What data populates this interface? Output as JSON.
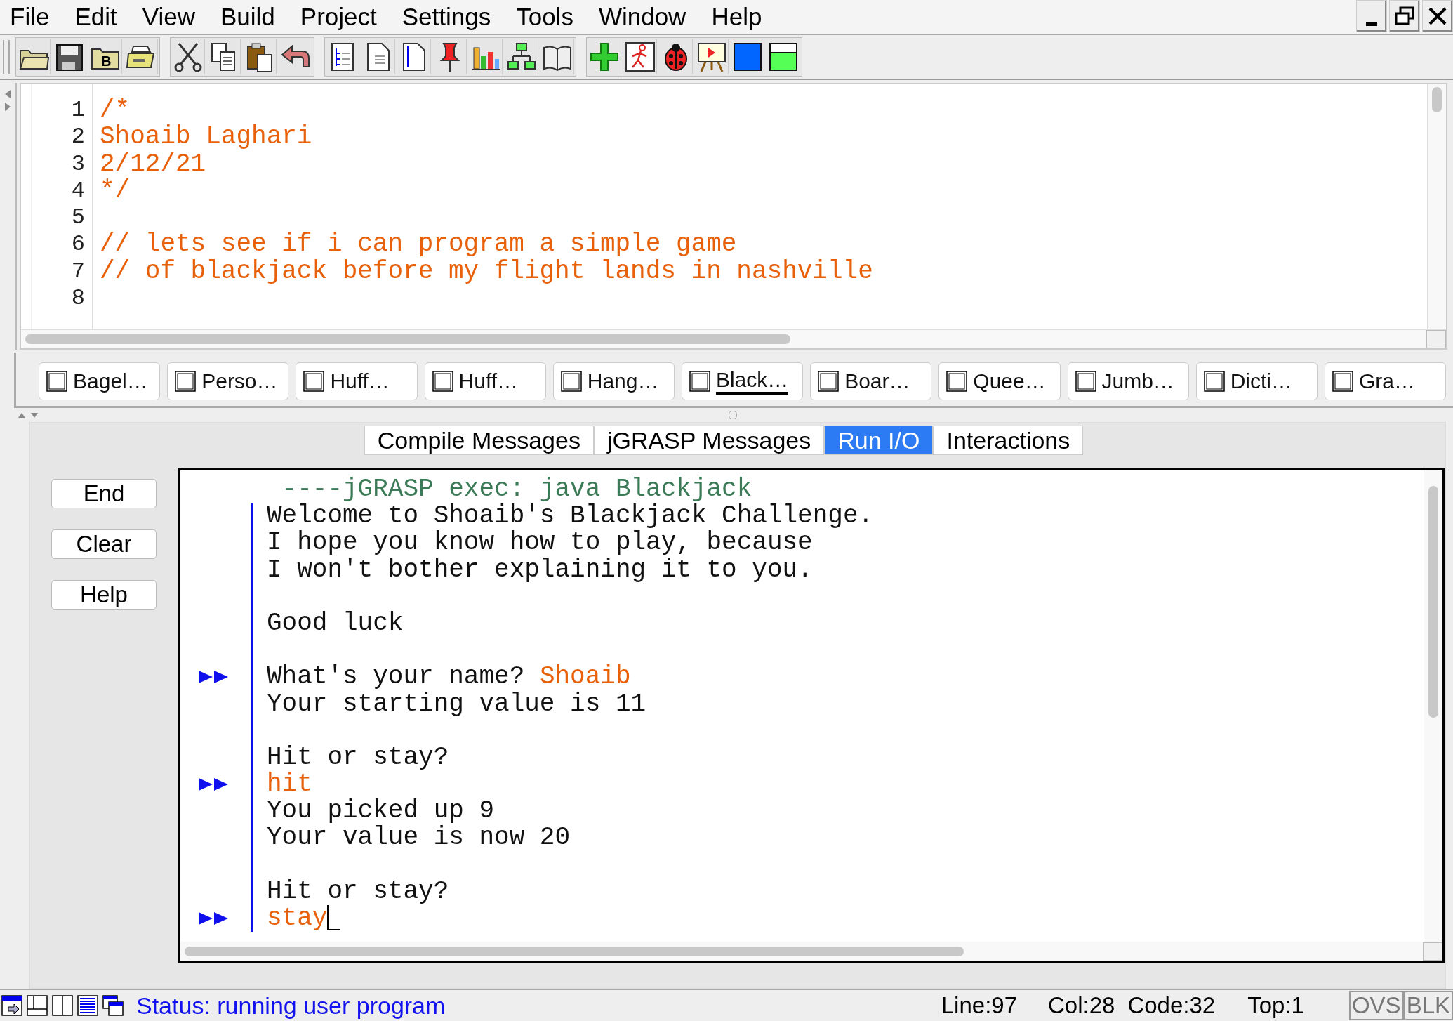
{
  "menu_bar": [
    "File",
    "Edit",
    "View",
    "Build",
    "Project",
    "Settings",
    "Tools",
    "Window",
    "Help"
  ],
  "toolbar": {
    "save_box_letter": "B"
  },
  "editor": {
    "lines": [
      {
        "number": "1",
        "text": "/*"
      },
      {
        "number": "2",
        "text": "Shoaib Laghari"
      },
      {
        "number": "3",
        "text": "2/12/21"
      },
      {
        "number": "4",
        "text": "*/"
      },
      {
        "number": "5"
      },
      {
        "number": "6",
        "text": "// lets see if i can program a simple game"
      },
      {
        "number": "7",
        "text": "// of blackjack before my flight lands in nashville"
      },
      {
        "number": "8"
      }
    ]
  },
  "file_tabs": [
    {
      "label": "Bagel…",
      "selected": false
    },
    {
      "label": "Perso…",
      "selected": false
    },
    {
      "label": "Huff…",
      "selected": false
    },
    {
      "label": "Huff…",
      "selected": false
    },
    {
      "label": "Hang…",
      "selected": false
    },
    {
      "label": "Black…",
      "selected": true
    },
    {
      "label": "Boar…",
      "selected": false
    },
    {
      "label": "Quee…",
      "selected": false
    },
    {
      "label": "Jumb…",
      "selected": false
    },
    {
      "label": "Dicti…",
      "selected": false
    },
    {
      "label": "Gra…",
      "selected": false
    }
  ],
  "message_tabs": [
    {
      "label": "Compile Messages",
      "selected": false
    },
    {
      "label": "jGRASP Messages",
      "selected": false
    },
    {
      "label": "Run I/O",
      "selected": true
    },
    {
      "label": "Interactions",
      "selected": false
    }
  ],
  "run_buttons": [
    "End",
    "Clear",
    "Help"
  ],
  "run_io": {
    "lines": [
      {
        "kind": "header",
        "text": " ----jGRASP exec: java Blackjack"
      },
      {
        "kind": "output",
        "text": "Welcome to Shoaib's Blackjack Challenge."
      },
      {
        "kind": "output",
        "text": "I hope you know how to play, because"
      },
      {
        "kind": "output",
        "text": "I won't bother explaining it to you."
      },
      {
        "kind": "blank"
      },
      {
        "kind": "output",
        "text": "Good luck"
      },
      {
        "kind": "blank"
      },
      {
        "kind": "output",
        "text": "What's your name? ",
        "input": "Shoaib",
        "prompt": true
      },
      {
        "kind": "output",
        "text": "Your starting value is 11"
      },
      {
        "kind": "blank"
      },
      {
        "kind": "output",
        "text": "Hit or stay?"
      },
      {
        "kind": "input",
        "input": "hit",
        "prompt": true
      },
      {
        "kind": "output",
        "text": "You picked up 9"
      },
      {
        "kind": "output",
        "text": "Your value is now 20"
      },
      {
        "kind": "blank"
      },
      {
        "kind": "output",
        "text": "Hit or stay?"
      },
      {
        "kind": "input",
        "input": "stay",
        "prompt": true,
        "cursor": true
      }
    ]
  },
  "status_bar": {
    "status": "Status: running user program",
    "line": "Line:97",
    "col": "Col:28",
    "code": "Code:32",
    "top": "Top:1",
    "indicators": [
      "OVS",
      "BLK"
    ]
  }
}
